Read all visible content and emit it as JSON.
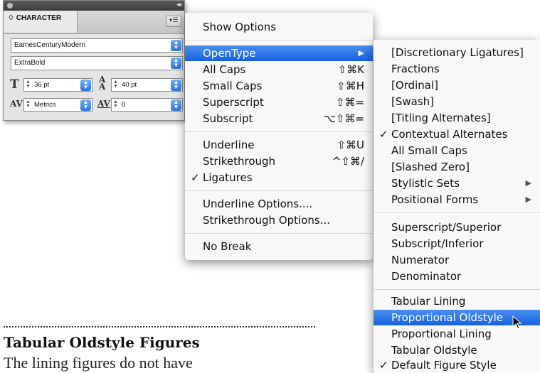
{
  "panel": {
    "tab_label": "♢ CHARACTER",
    "menu_button_glyph": "▾☰",
    "collapse_glyph": "◂◂",
    "font_family": "EamesCenturyModern",
    "font_style": "ExtraBold",
    "font_size": "36 pt",
    "leading": "40 pt",
    "kerning": "Metrics",
    "tracking": "0",
    "icons": [
      "font-size-icon",
      "leading-icon",
      "kerning-icon",
      "tracking-icon"
    ]
  },
  "menu1": {
    "items": [
      {
        "label": "Show Options"
      },
      {
        "label": "OpenType",
        "submenu_arrow": "▶"
      },
      {
        "label": "All Caps",
        "shortcut": "⇧⌘K"
      },
      {
        "label": "Small Caps",
        "shortcut": "⇧⌘H"
      },
      {
        "label": "Superscript",
        "shortcut": "⇧⌘="
      },
      {
        "label": "Subscript",
        "shortcut": "⌥⇧⌘="
      },
      {
        "label": "Underline",
        "shortcut": "⇧⌘U"
      },
      {
        "label": "Strikethrough",
        "shortcut": "^⇧⌘/"
      },
      {
        "label": "Ligatures",
        "checkmark": "✓"
      },
      {
        "label": "Underline Options...."
      },
      {
        "label": "Strikethrough Options..."
      },
      {
        "label": "No Break"
      }
    ]
  },
  "menu2": {
    "items": [
      {
        "label": "[Discretionary Ligatures]"
      },
      {
        "label": "Fractions"
      },
      {
        "label": "[Ordinal]"
      },
      {
        "label": "[Swash]"
      },
      {
        "label": "[Titling Alternates]"
      },
      {
        "label": "Contextual Alternates",
        "checkmark": "✓"
      },
      {
        "label": "All Small Caps"
      },
      {
        "label": "[Slashed Zero]"
      },
      {
        "label": "Stylistic Sets",
        "submenu_arrow": "▶"
      },
      {
        "label": "Positional Forms",
        "submenu_arrow": "▶"
      },
      {
        "label": "Superscript/Superior"
      },
      {
        "label": "Subscript/Inferior"
      },
      {
        "label": "Numerator"
      },
      {
        "label": "Denominator"
      },
      {
        "label": "Tabular Lining"
      },
      {
        "label": "Proportional Oldstyle"
      },
      {
        "label": "Proportional Lining"
      },
      {
        "label": "Tabular Oldstyle"
      },
      {
        "label": "Default Figure Style",
        "checkmark": "✓"
      }
    ]
  },
  "caption": {
    "heading": "Tabular Oldstyle Figures",
    "body": "The lining figures do not have"
  },
  "colors": {
    "highlight": "#1f6ae6",
    "stepper": "#3b82e0"
  }
}
